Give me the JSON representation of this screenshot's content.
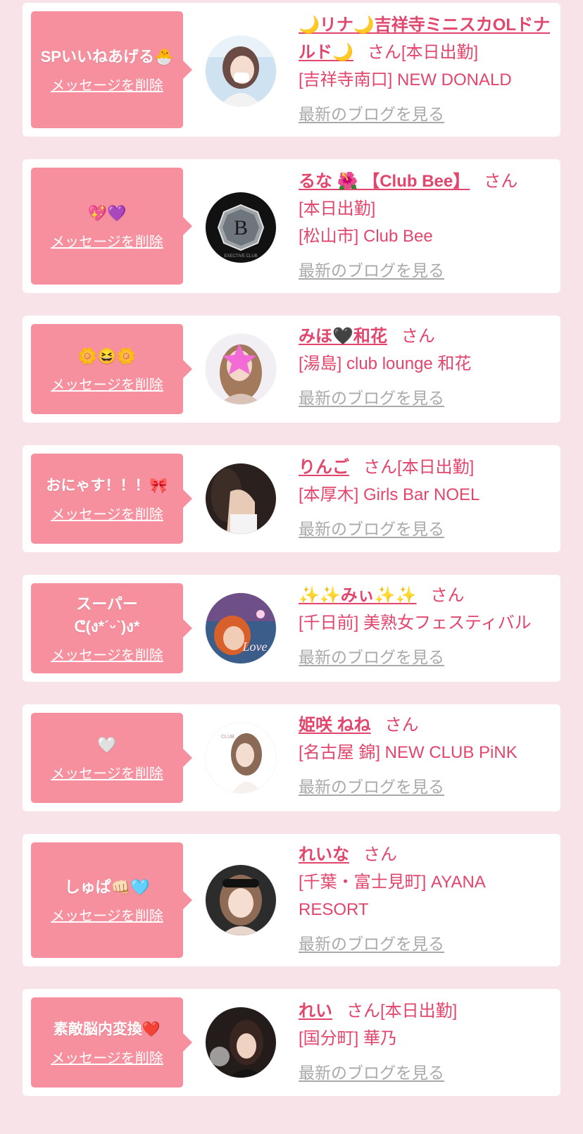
{
  "suffix": "さん",
  "delete_label": "メッセージを削除",
  "blog_label": "最新のブログを見る",
  "cards": [
    {
      "message": "SPいいねあげる🐣",
      "name": "🌙リナ🌙吉祥寺ミニスカOLドナルド🌙",
      "status": "[本日出勤]",
      "shop": "[吉祥寺南口] NEW DONALD",
      "avatar": "woman-photo"
    },
    {
      "message": "💖💜",
      "name": "るな 🌺 【Club Bee】",
      "status": "[本日出勤]",
      "shop": "[松山市] Club Bee",
      "avatar": "club-logo-b"
    },
    {
      "message": "🌼😆🌼",
      "name": "みほ🖤和花",
      "status": "",
      "shop": "[湯島] club lounge 和花",
      "avatar": "woman-photo-star"
    },
    {
      "message": "おにゃす！！！🎀",
      "name": "りんご",
      "status": "[本日出勤]",
      "shop": "[本厚木] Girls Bar NOEL",
      "avatar": "woman-photo-dark"
    },
    {
      "message": "スーパーᕦ(ง*ˊᵕˋ)ง*",
      "name": "✨✨みぃ✨✨",
      "status": "",
      "shop": "[千日前] 美熟女フェスティバル",
      "avatar": "woman-photo-love"
    },
    {
      "message": "🤍",
      "name": "姫咲 ねね",
      "status": "",
      "shop": "[名古屋 錦] NEW CLUB PiNK",
      "avatar": "woman-photo-white"
    },
    {
      "message": "しゅぱ👊🏻🩵",
      "name": "れいな",
      "status": "",
      "shop": "[千葉・富士見町] AYANA RESORT",
      "avatar": "woman-photo-doll"
    },
    {
      "message": "素敵脳内変換❤️",
      "name": "れい",
      "status": "[本日出勤]",
      "shop": "[国分町] 華乃",
      "avatar": "woman-photo-night"
    }
  ],
  "colors": {
    "accent": "#e2466c",
    "bubble": "#f7909e",
    "background": "#f7e3e8",
    "link_gray": "#a9a9a9"
  }
}
